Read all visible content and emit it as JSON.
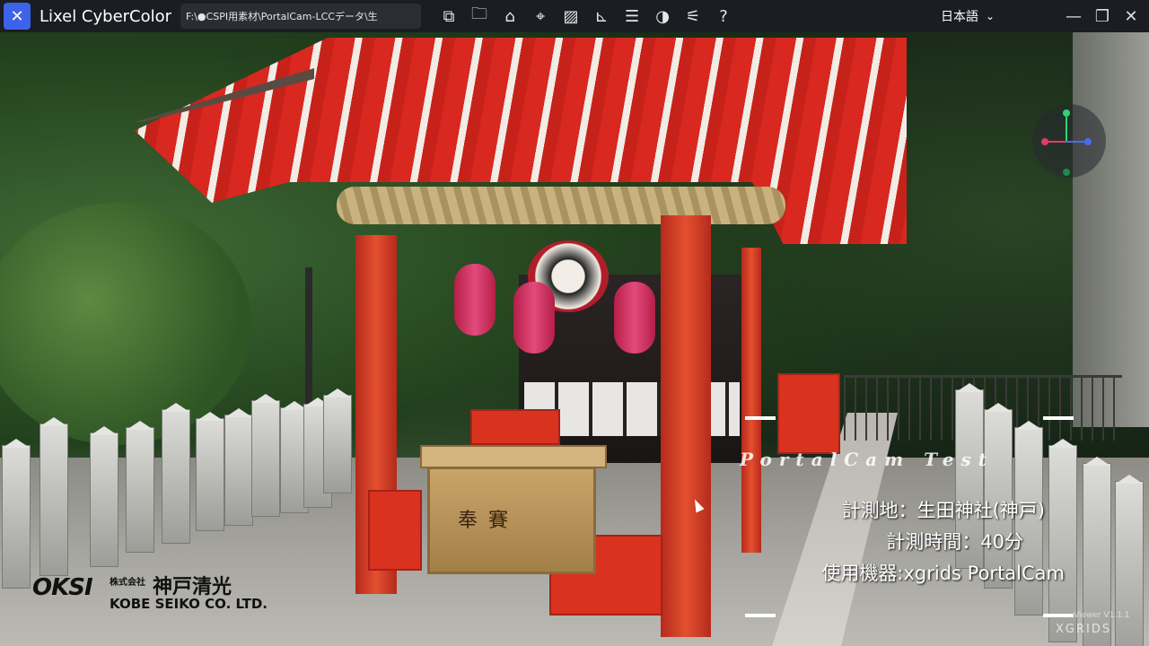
{
  "titlebar": {
    "app_name": "Lixel CyberColor",
    "file_path": "F:\\●CSPI用素材\\PortalCam-LCCデータ\\生",
    "language": "日本語",
    "tool_icons": [
      "copy-icon",
      "folder-icon",
      "home-icon",
      "location-pin-icon",
      "image-icon",
      "measure-icon",
      "list-icon",
      "vr-headset-icon",
      "sliders-icon",
      "help-icon"
    ]
  },
  "overlay": {
    "title": "PortalCam Test",
    "location": "計測地：生田神社(神戸)",
    "duration": "計測時間：40分",
    "device": "使用機器:xgrids PortalCam"
  },
  "logo": {
    "mark": "OKSI",
    "company_prefix": "株式会社",
    "company_name_jp": "神戸清光",
    "company_name_en": "KOBE SEIKO CO. LTD."
  },
  "offering_box": {
    "label": "奉賽"
  },
  "watermark": {
    "viewer": "Viewer V1.1.1",
    "brand": "XGRIDS"
  },
  "colors": {
    "accent": "#3d63e8",
    "titlebar_bg": "#1b1d22"
  }
}
